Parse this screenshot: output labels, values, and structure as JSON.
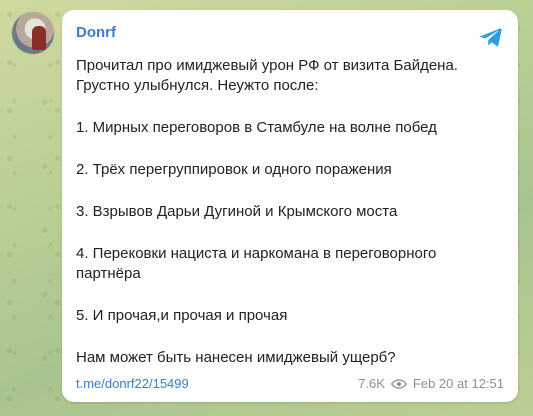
{
  "post": {
    "channel_name": "Donrf",
    "paragraphs": [
      "Прочитал про имиджевый урон РФ от визита Байдена. Грустно улыбнулся. Неужто после:",
      "1. Мирных переговоров в Стамбуле на волне побед",
      "2. Трёх перегруппировок и одного поражения",
      "3. Взрывов Дарьи Дугиной и Крымского моста",
      "4. Перековки нациста и наркомана в переговорного партнёра",
      "5. И прочая,и прочая и прочая",
      "Нам может быть нанесен имиджевый ущерб?"
    ],
    "link": "t.me/donrf22/15499",
    "views": "7.6K",
    "date": "Feb 20 at 12:51"
  },
  "icons": {
    "share": "telegram-share-icon",
    "views": "eye-icon"
  },
  "colors": {
    "accent": "#3a7fc4",
    "meta": "#8b8f96"
  }
}
